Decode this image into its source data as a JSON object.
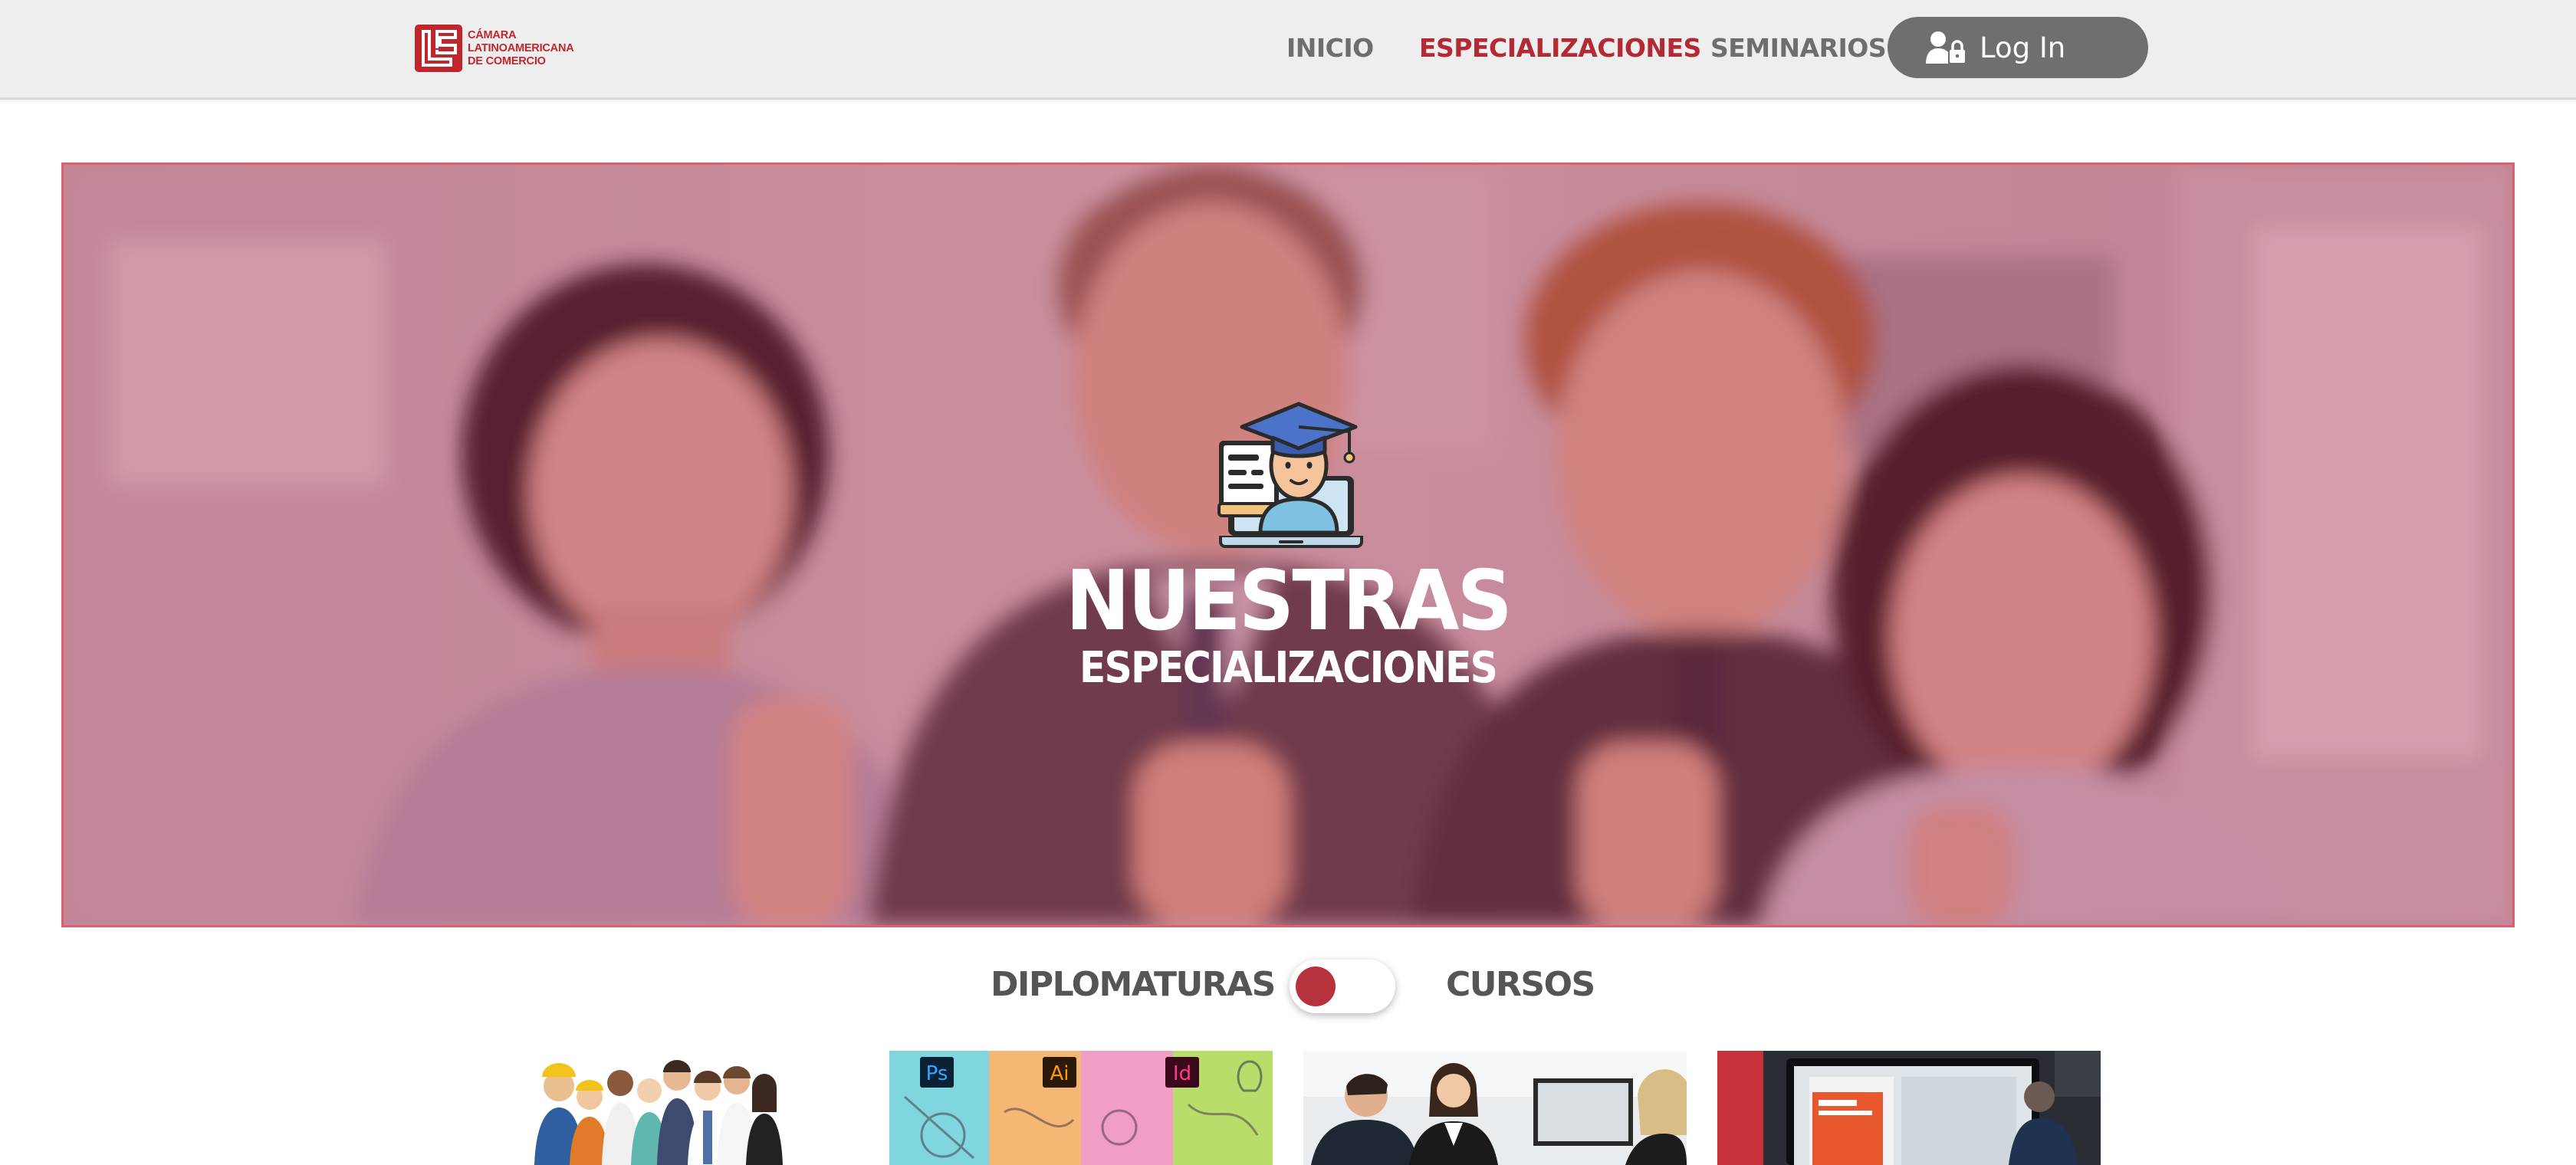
{
  "header": {
    "logo": {
      "lines": [
        "CÁMARA",
        "LATINOAMERICANA",
        "DE COMERCIO"
      ]
    },
    "nav": [
      {
        "label": "INICIO",
        "active": false
      },
      {
        "label": "ESPECIALIZACIONES",
        "active": true
      },
      {
        "label": "SEMINARIOS",
        "active": false
      }
    ],
    "login": {
      "label": "Log In",
      "icon": "user-lock-icon"
    }
  },
  "hero": {
    "title": "NUESTRAS",
    "subtitle": "ESPECIALIZACIONES",
    "icon": "graduate-laptop-icon"
  },
  "filter": {
    "left_label": "DIPLOMATURAS",
    "right_label": "CURSOS",
    "toggle_position": "left"
  },
  "cards": {
    "card_2_labels": [
      "Ps",
      "Ai",
      "Id"
    ]
  },
  "colors": {
    "brand_red": "#b32a34",
    "nav_gray": "#6e6e6e",
    "login_bg": "#6f6f6f",
    "toggle_knob": "#b7323c"
  }
}
